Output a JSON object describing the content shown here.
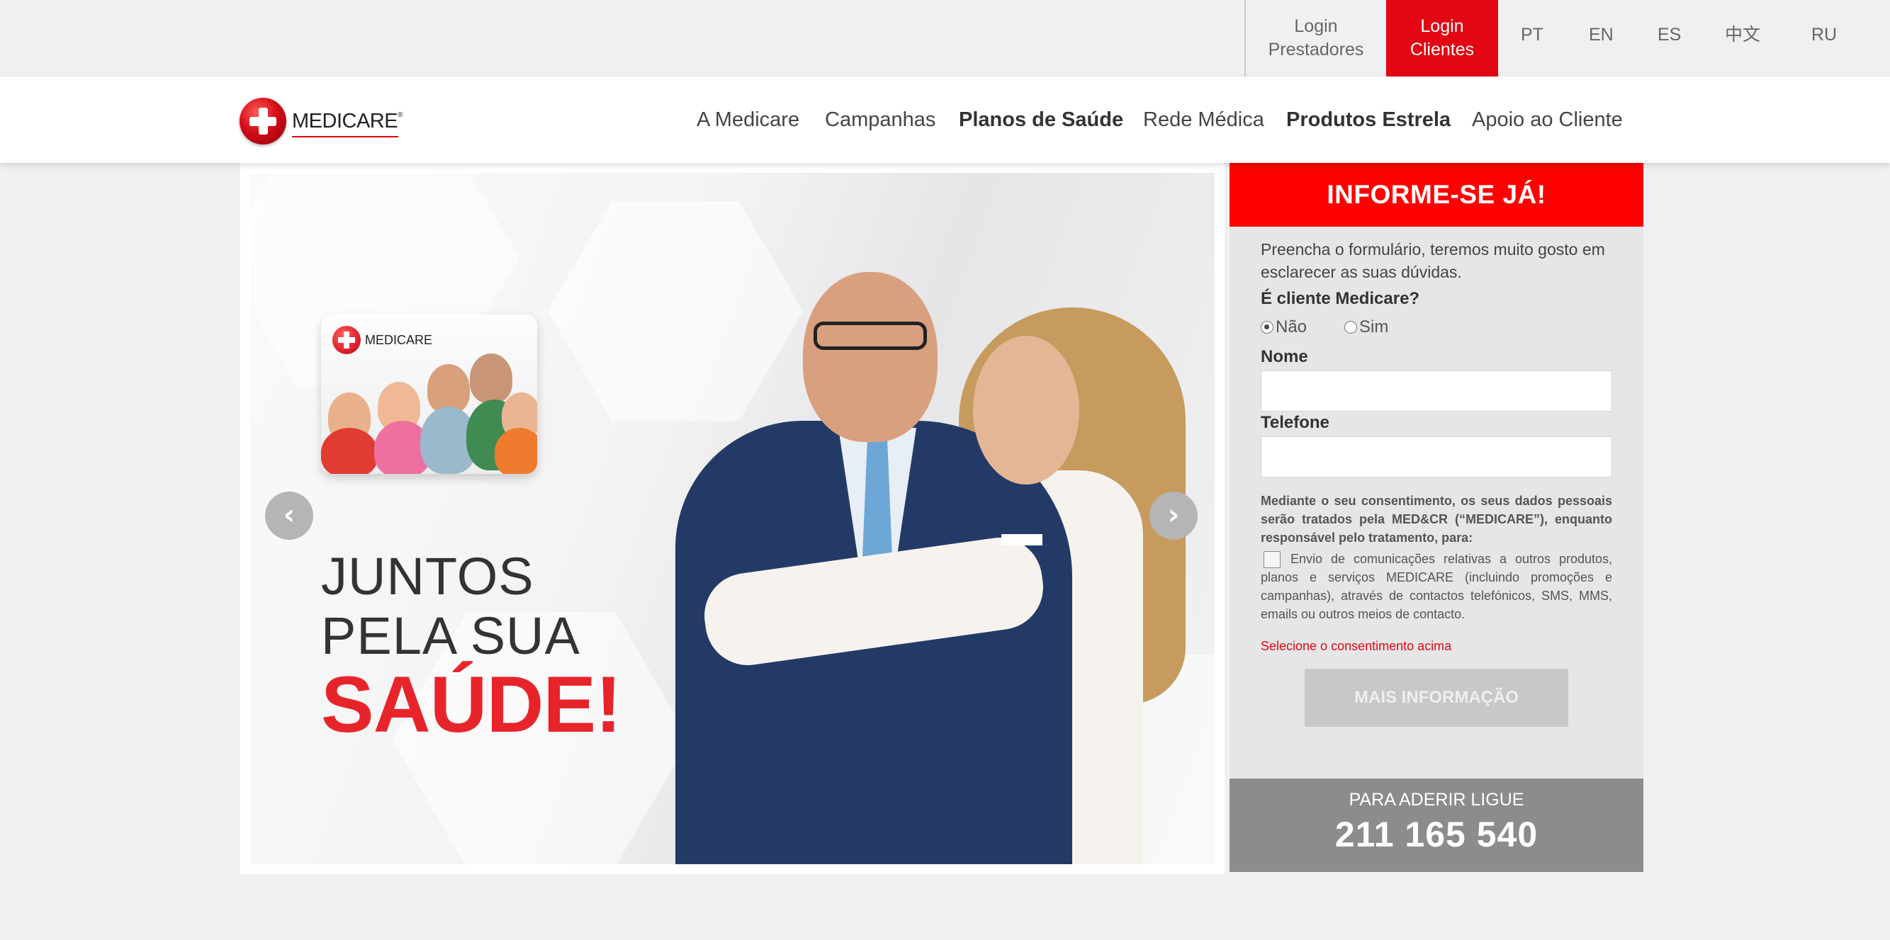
{
  "topbar": {
    "login_prestadores_line1": "Login",
    "login_prestadores_line2": "Prestadores",
    "login_clientes_line1": "Login",
    "login_clientes_line2": "Clientes",
    "languages": [
      "PT",
      "EN",
      "ES",
      "中文",
      "RU"
    ],
    "accent_color": "#e30613"
  },
  "header": {
    "logo_text": "MEDICARE",
    "logo_reg": "®",
    "nav": [
      "A Medicare",
      "Campanhas",
      "Planos de Saúde",
      "Rede Médica",
      "Produtos Estrela",
      "Apoio ao Cliente"
    ]
  },
  "hero": {
    "card_logo_text": "MEDICARE",
    "headline_line1": "JUNTOS",
    "headline_line2": "PELA SUA",
    "headline_big": "SAÚDE!",
    "prev_icon": "‹",
    "next_icon": "›",
    "headline_accent_color": "#e8242b"
  },
  "form": {
    "title": "INFORME-SE JÁ!",
    "intro": "Preencha o formulário, teremos muito gosto em esclarecer as suas dúvidas.",
    "client_question": "É cliente Medicare?",
    "radio_no": "Não",
    "radio_yes": "Sim",
    "name_label": "Nome",
    "phone_label": "Telefone",
    "name_value": "",
    "phone_value": "",
    "consent_text": "Mediante o seu consentimento, os seus dados pessoais serão tratados pela MED&CR (“MEDICARE”), enquanto responsável pelo tratamento, para:",
    "consent_option": "Envio de comunicações relativas a outros produtos, planos e serviços MEDICARE (incluindo promoções e campanhas), através de contactos telefónicos, SMS, MMS, emails ou outros meios de contacto.",
    "error_text": "Selecione o consentimento acima",
    "submit_label": "MAIS INFORMAÇÃO",
    "header_color": "#fe0000"
  },
  "call": {
    "label": "PARA ADERIR LIGUE",
    "phone": "211 165 540"
  }
}
